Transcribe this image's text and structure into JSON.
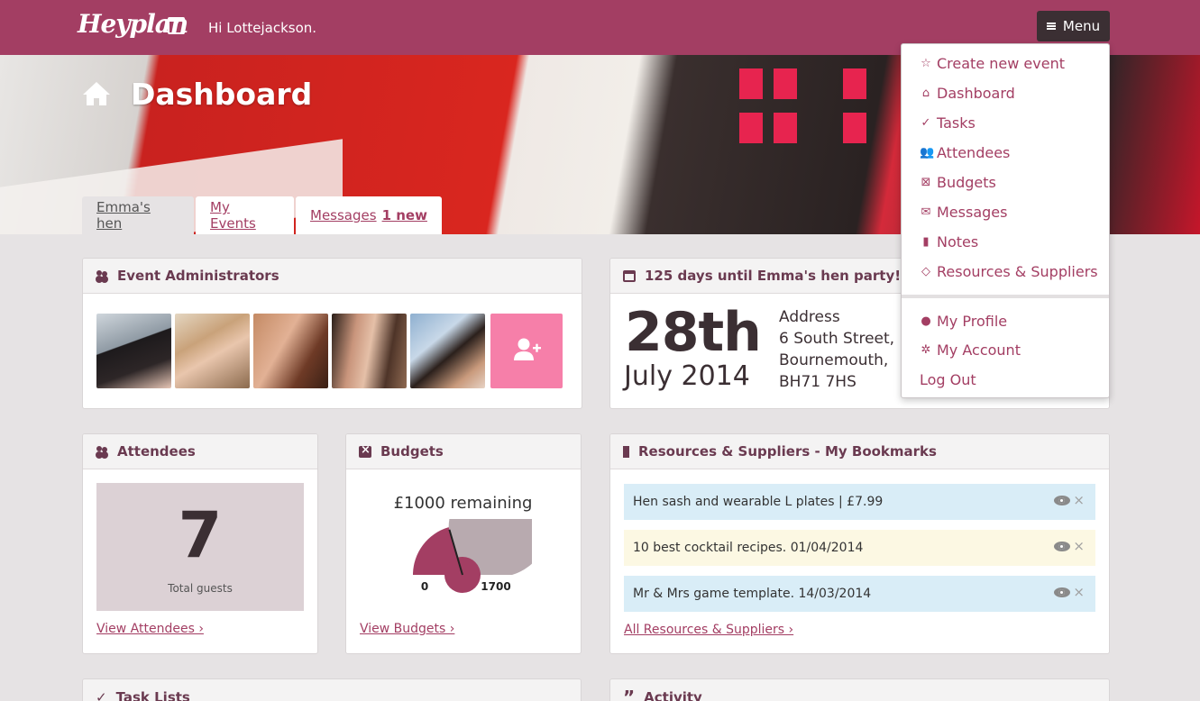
{
  "header": {
    "logo_text": "Heyplan",
    "greeting": "Hi Lottejackson.",
    "menu_label": "Menu"
  },
  "page": {
    "title": "Dashboard"
  },
  "tabs": [
    {
      "label": "Emma's hen",
      "active": true
    },
    {
      "label": "My Events",
      "active": false
    },
    {
      "label": "Messages",
      "badge": "1 new",
      "active": false
    }
  ],
  "admins_panel": {
    "title": "Event Administrators",
    "avatars": [
      "avatar-1",
      "avatar-2",
      "avatar-3",
      "avatar-4",
      "avatar-5"
    ],
    "add_icon": "add-user-icon"
  },
  "countdown_panel": {
    "title": "125 days until Emma's hen party!",
    "day": "28th",
    "month_year": "July 2014",
    "address_label": "Address",
    "address_lines": [
      "6 South Street,",
      "Bournemouth,",
      "BH71 7HS"
    ]
  },
  "attendees_panel": {
    "title": "Attendees",
    "count": "7",
    "count_label": "Total guests",
    "link": "View Attendees ›"
  },
  "budgets_panel": {
    "title": "Budgets",
    "remaining": "£1000 remaining",
    "gauge": {
      "min": "0",
      "max": "1700",
      "spent_fraction": 0.41
    },
    "link": "View Budgets ›"
  },
  "resources_panel": {
    "title": "Resources & Suppliers - My Bookmarks",
    "bookmarks": [
      {
        "text": "Hen sash and wearable L plates | £7.99",
        "bg": "#d9edf7"
      },
      {
        "text": "10 best cocktail recipes. 01/04/2014",
        "bg": "#fcf8e3"
      },
      {
        "text": "Mr & Mrs game template. 14/03/2014",
        "bg": "#d9edf7"
      }
    ],
    "link": "All Resources & Suppliers ›"
  },
  "tasks_panel": {
    "title": "Task Lists"
  },
  "activity_panel": {
    "title": "Activity"
  },
  "menu": {
    "items": [
      {
        "label": "Create new event",
        "icon": "star-icon"
      },
      {
        "label": "Dashboard",
        "icon": "home-icon"
      },
      {
        "label": "Tasks",
        "icon": "check-icon"
      },
      {
        "label": "Attendees",
        "icon": "people-icon"
      },
      {
        "label": "Budgets",
        "icon": "budget-icon"
      },
      {
        "label": "Messages",
        "icon": "envelope-icon"
      },
      {
        "label": "Notes",
        "icon": "book-icon"
      },
      {
        "label": "Resources & Suppliers",
        "icon": "tags-icon"
      }
    ],
    "account_items": [
      {
        "label": "My Profile",
        "icon": "user-icon"
      },
      {
        "label": "My Account",
        "icon": "cog-icon"
      },
      {
        "label": "Log Out",
        "icon": ""
      }
    ]
  },
  "colors": {
    "brand": "#a33e63",
    "dark": "#3b2f33",
    "accent_pink": "#f67fa9",
    "gauge_spent": "#a33e63",
    "gauge_remaining": "#b8aaaf"
  }
}
